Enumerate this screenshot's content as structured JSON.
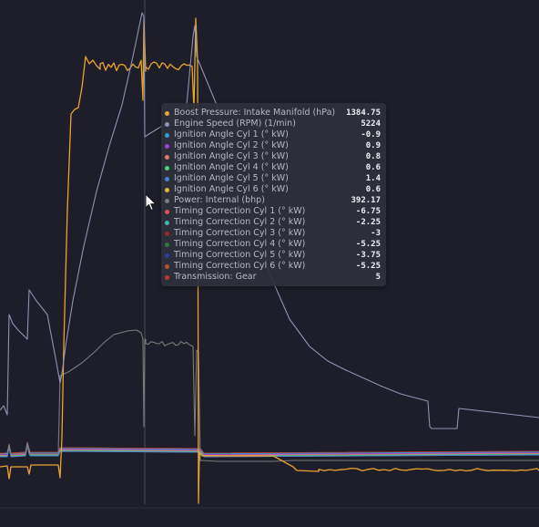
{
  "chart_data": {
    "type": "line",
    "xlabel": "",
    "ylabel": "",
    "grid": false,
    "legend": "tooltip",
    "series": [
      {
        "name": "Boost Pressure: Intake Manifold (hPa)",
        "color": "#e8a430",
        "tooltip_value": "1384.75"
      },
      {
        "name": "Engine Speed (RPM) (1/min)",
        "color": "#8f93b3",
        "tooltip_value": "5224"
      },
      {
        "name": "Ignition Angle Cyl 1 (° kW)",
        "color": "#2e9bd6",
        "tooltip_value": "-0.9"
      },
      {
        "name": "Ignition Angle Cyl 2 (° kW)",
        "color": "#9b43d6",
        "tooltip_value": "0.9"
      },
      {
        "name": "Ignition Angle Cyl 3 (° kW)",
        "color": "#e07a6a",
        "tooltip_value": "0.8"
      },
      {
        "name": "Ignition Angle Cyl 4 (° kW)",
        "color": "#4fd07a",
        "tooltip_value": "0.6"
      },
      {
        "name": "Ignition Angle Cyl 5 (° kW)",
        "color": "#4a7fe0",
        "tooltip_value": "1.4"
      },
      {
        "name": "Ignition Angle Cyl 6 (° kW)",
        "color": "#e0b83a",
        "tooltip_value": "0.6"
      },
      {
        "name": "Power: Internal (bhp)",
        "color": "#7b7b7b",
        "tooltip_value": "392.17"
      },
      {
        "name": "Timing Correction Cyl 1 (° kW)",
        "color": "#e24f5f",
        "tooltip_value": "-6.75"
      },
      {
        "name": "Timing Correction Cyl 2 (° kW)",
        "color": "#3ab9ad",
        "tooltip_value": "-2.25"
      },
      {
        "name": "Timing Correction Cyl 3 (° kW)",
        "color": "#9a2a2a",
        "tooltip_value": "-3"
      },
      {
        "name": "Timing Correction Cyl 4 (° kW)",
        "color": "#2f7a3e",
        "tooltip_value": "-5.25"
      },
      {
        "name": "Timing Correction Cyl 5 (° kW)",
        "color": "#2e3f9e",
        "tooltip_value": "-3.75"
      },
      {
        "name": "Timing Correction Cyl 6 (° kW)",
        "color": "#b5542a",
        "tooltip_value": "-5.25"
      },
      {
        "name": "Transmission: Gear",
        "color": "#b83a2a",
        "tooltip_value": "5"
      }
    ]
  },
  "cursor_icon": "mouse-pointer-icon"
}
